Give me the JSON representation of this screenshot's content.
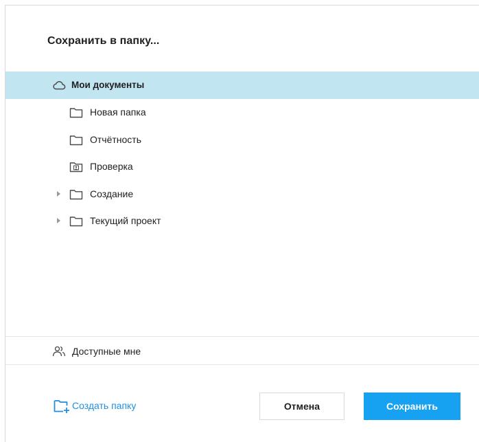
{
  "dialog": {
    "title": "Сохранить в папку...",
    "root": {
      "label": "Мои документы",
      "icon": "cloud-icon",
      "selected": true
    },
    "folders": [
      {
        "label": "Новая папка",
        "icon": "folder-icon",
        "expandable": false
      },
      {
        "label": "Отчётность",
        "icon": "folder-icon",
        "expandable": false
      },
      {
        "label": "Проверка",
        "icon": "shared-folder-icon",
        "expandable": false
      },
      {
        "label": "Создание",
        "icon": "folder-icon",
        "expandable": true
      },
      {
        "label": "Текущий проект",
        "icon": "folder-icon",
        "expandable": true
      }
    ],
    "shared": {
      "label": "Доступные мне",
      "icon": "users-icon"
    },
    "create_folder_label": "Создать папку",
    "cancel_label": "Отмена",
    "save_label": "Сохранить"
  },
  "colors": {
    "selected_bg": "#c2e5f2",
    "accent": "#16a2f0",
    "link": "#1f8fe0"
  }
}
